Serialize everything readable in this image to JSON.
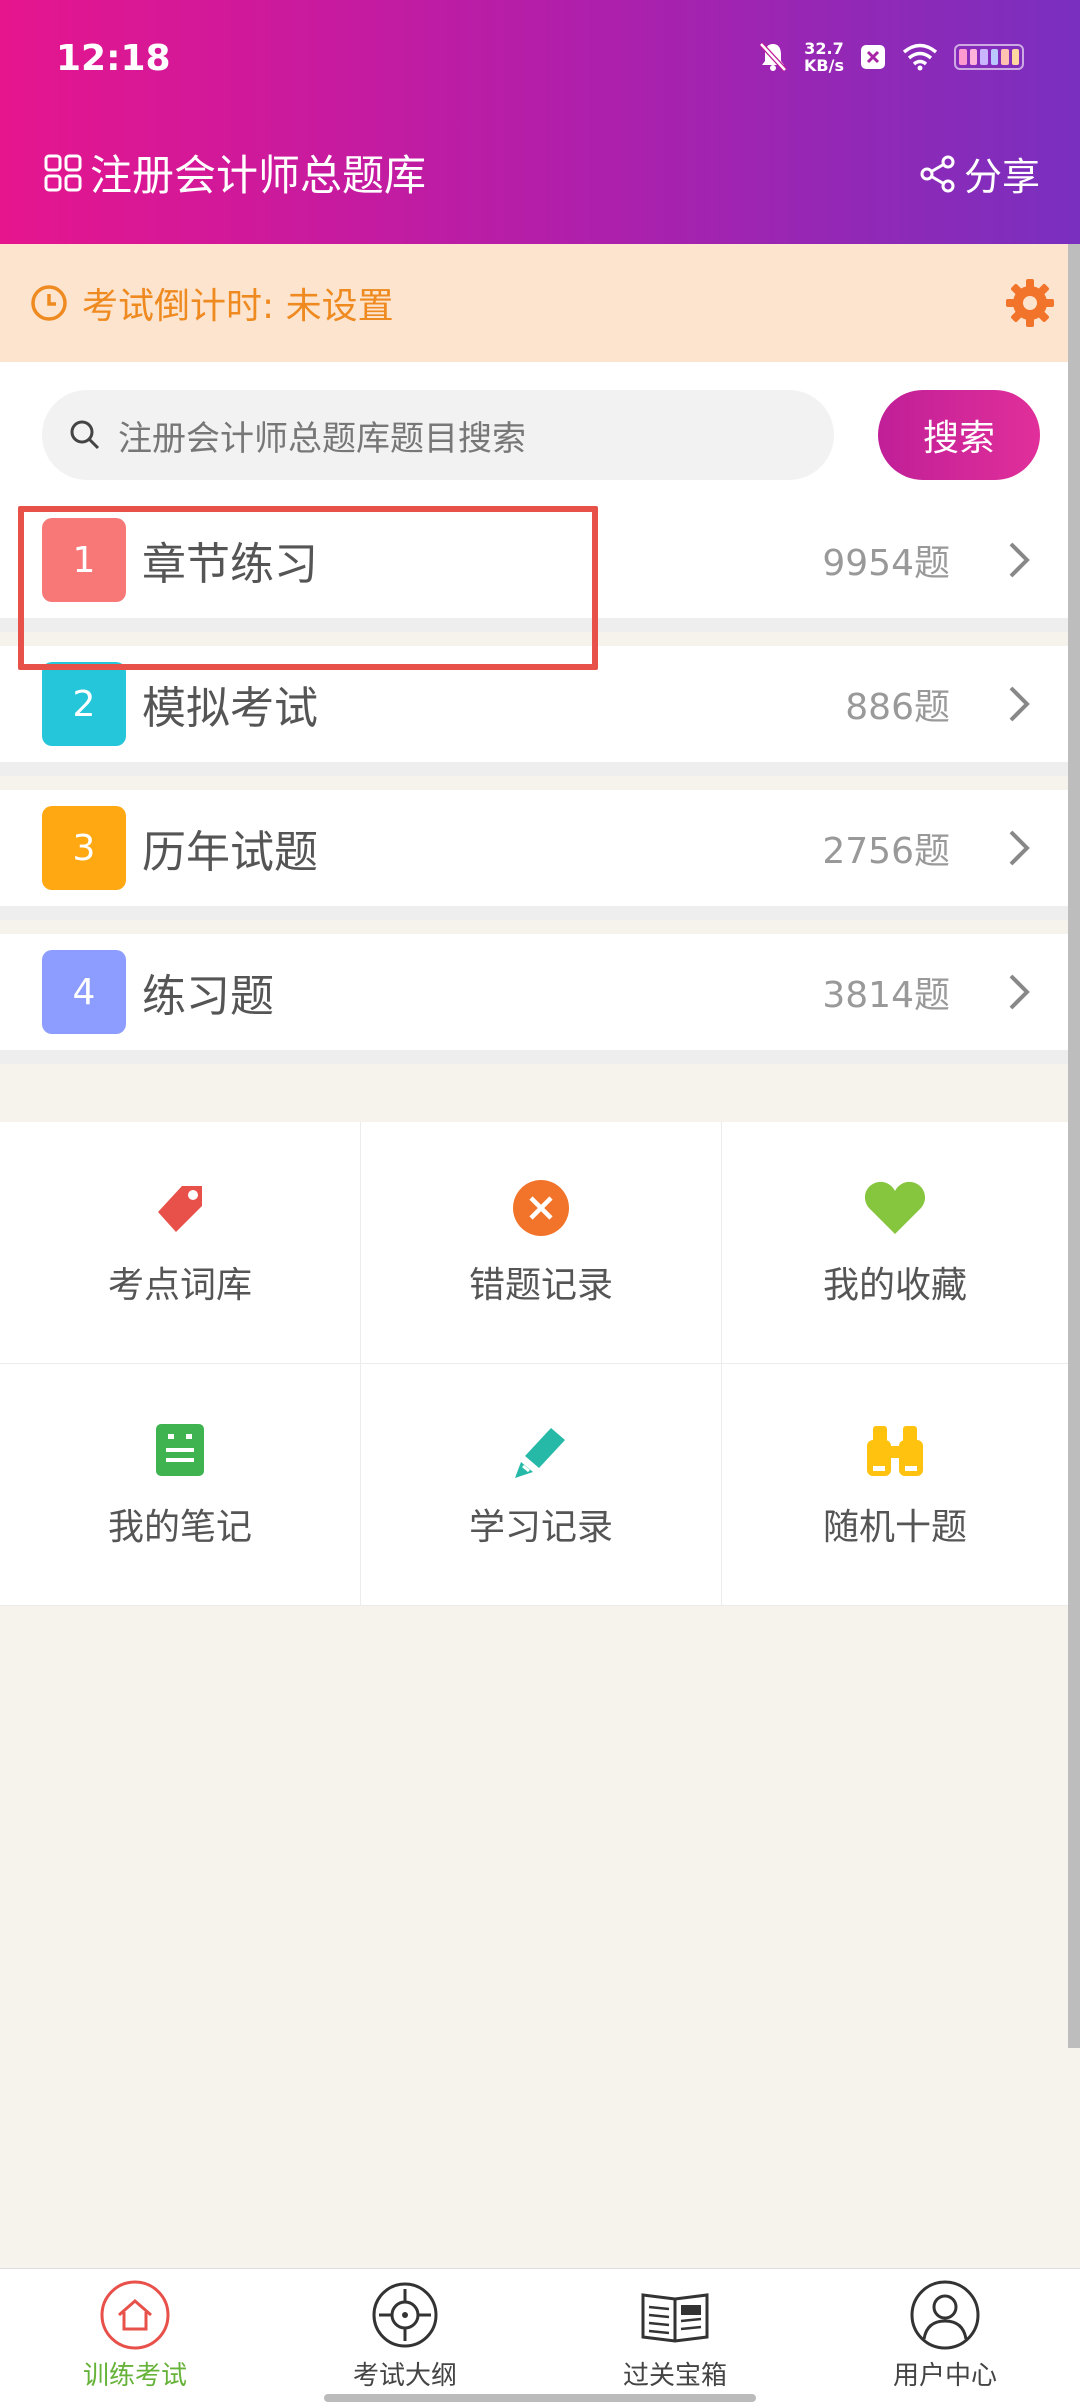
{
  "status_bar": {
    "time": "12:18",
    "speed_value": "32.7",
    "speed_unit": "KB/s"
  },
  "header": {
    "title": "注册会计师总题库",
    "share_label": "分享"
  },
  "countdown": {
    "label": "考试倒计时: 未设置"
  },
  "search": {
    "placeholder": "注册会计师总题库题目搜索",
    "button_label": "搜索"
  },
  "menu": [
    {
      "number": "1",
      "label": "章节练习",
      "count": "9954题",
      "color": "#f87878"
    },
    {
      "number": "2",
      "label": "模拟考试",
      "count": "886题",
      "color": "#26c6da"
    },
    {
      "number": "3",
      "label": "历年试题",
      "count": "2756题",
      "color": "#ffa812"
    },
    {
      "number": "4",
      "label": "练习题",
      "count": "3814题",
      "color": "#8c9cff"
    }
  ],
  "tools": [
    {
      "label": "考点词库",
      "icon": "tag-icon",
      "color": "#e8504a"
    },
    {
      "label": "错题记录",
      "icon": "close-circle-icon",
      "color": "#f2742a"
    },
    {
      "label": "我的收藏",
      "icon": "heart-icon",
      "color": "#86c53e"
    },
    {
      "label": "我的笔记",
      "icon": "notebook-icon",
      "color": "#3fb34f"
    },
    {
      "label": "学习记录",
      "icon": "pen-icon",
      "color": "#26b9a8"
    },
    {
      "label": "随机十题",
      "icon": "binoculars-icon",
      "color": "#ffc20e"
    }
  ],
  "bottom_nav": [
    {
      "label": "训练考试",
      "icon": "home-icon",
      "active": true
    },
    {
      "label": "考试大纲",
      "icon": "target-icon",
      "active": false
    },
    {
      "label": "过关宝箱",
      "icon": "newspaper-icon",
      "active": false
    },
    {
      "label": "用户中心",
      "icon": "user-icon",
      "active": false
    }
  ],
  "colors": {
    "accent": "#c01f98",
    "active_nav": "#67b33a",
    "countdown_text": "#ee8a1f"
  }
}
